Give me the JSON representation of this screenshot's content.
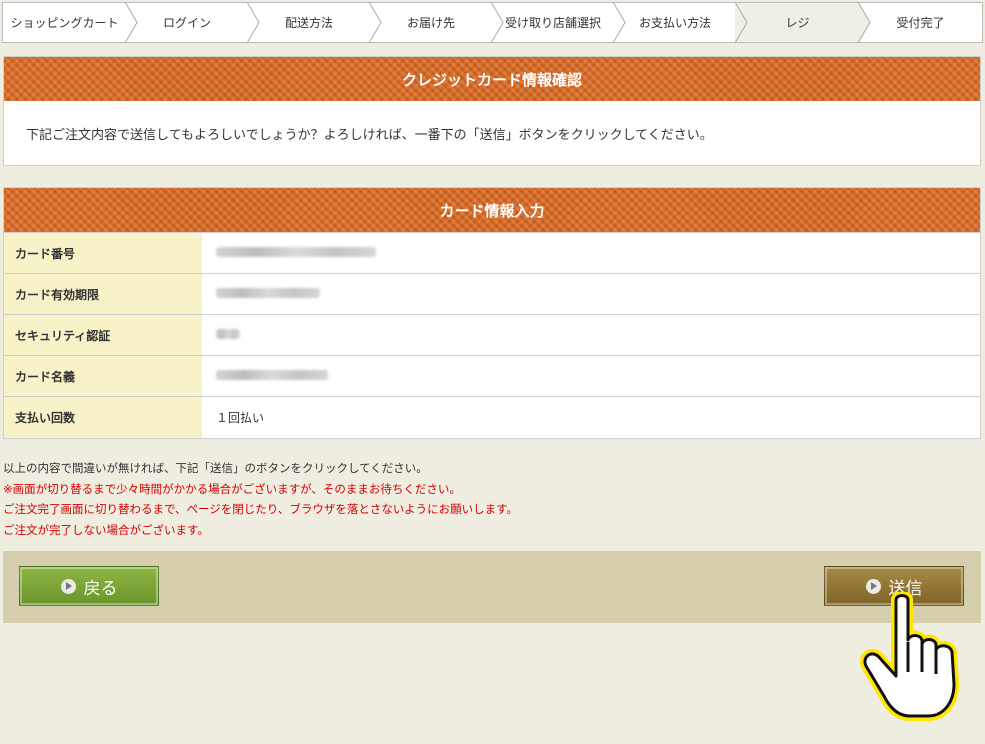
{
  "steps": [
    {
      "label": "ショッピングカート"
    },
    {
      "label": "ログイン"
    },
    {
      "label": "配送方法"
    },
    {
      "label": "お届け先"
    },
    {
      "label": "受け取り店舗選択"
    },
    {
      "label": "お支払い方法"
    },
    {
      "label": "レジ",
      "active": true
    },
    {
      "label": "受付完了"
    }
  ],
  "confirm": {
    "title": "クレジットカード情報確認",
    "message": "下記ご注文内容で送信してもよろしいでしょうか？よろしければ、一番下の「送信」ボタンをクリックしてください。"
  },
  "card": {
    "title": "カード情報入力",
    "rows": [
      {
        "label": "カード番号",
        "value": ""
      },
      {
        "label": "カード有効期限",
        "value": ""
      },
      {
        "label": "セキュリティ認証",
        "value": ""
      },
      {
        "label": "カード名義",
        "value": ""
      },
      {
        "label": "支払い回数",
        "value": "１回払い"
      }
    ]
  },
  "notes": {
    "line1": "以上の内容で間違いが無ければ、下記「送信」のボタンをクリックしてください。",
    "red": [
      "※画面が切り替るまで少々時間がかかる場合がございますが、そのままお待ちください。",
      "ご注文完了画面に切り替わるまで、ページを閉じたり、ブラウザを落とさないようにお願いします。",
      "ご注文が完了しない場合がございます。"
    ]
  },
  "buttons": {
    "back": "戻る",
    "send": "送信"
  }
}
